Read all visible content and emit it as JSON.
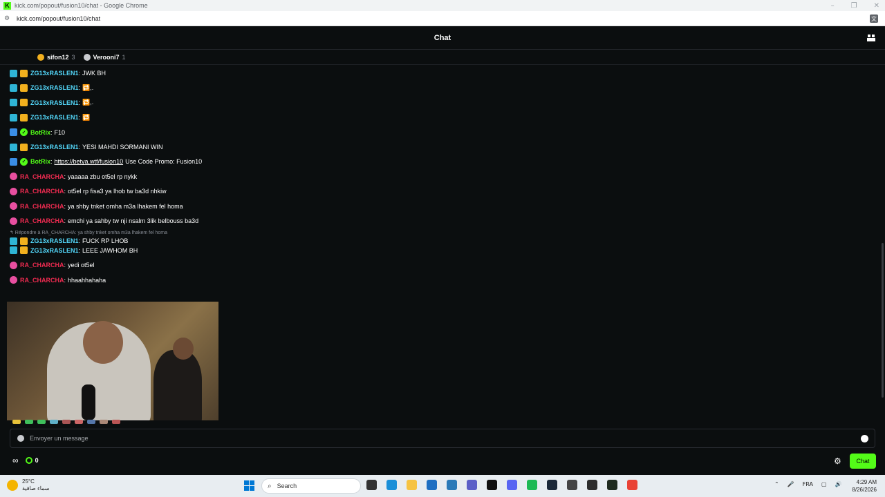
{
  "browser": {
    "window_title": "kick.com/popout/fusion10/chat - Google Chrome",
    "favicon_letter": "K",
    "url": "kick.com/popout/fusion10/chat"
  },
  "header": {
    "title": "Chat"
  },
  "gifters": [
    {
      "name": "sifon12",
      "count": "3",
      "color": "#f2b01e"
    },
    {
      "name": "Verooni7",
      "count": "1",
      "color": "#c9cbcf"
    }
  ],
  "messages": [
    {
      "badges": [
        "sub",
        "crown"
      ],
      "user": "ZG13xRASLEN1",
      "user_color": "#53d8fb",
      "text": "JWK BH",
      "link": ""
    },
    {
      "badges": [
        "sub",
        "crown"
      ],
      "user": "ZG13xRASLEN1",
      "user_color": "#53d8fb",
      "text": "🔁,.",
      "link": ""
    },
    {
      "badges": [
        "sub",
        "crown"
      ],
      "user": "ZG13xRASLEN1",
      "user_color": "#53d8fb",
      "text": "🔁,.",
      "link": ""
    },
    {
      "badges": [
        "sub",
        "crown"
      ],
      "user": "ZG13xRASLEN1",
      "user_color": "#53d8fb",
      "text": "🔁",
      "link": ""
    },
    {
      "badges": [
        "bot",
        "verified"
      ],
      "user": "BotRix",
      "user_color": "#53fc18",
      "text": "F10",
      "link": ""
    },
    {
      "badges": [
        "sub",
        "crown"
      ],
      "user": "ZG13xRASLEN1",
      "user_color": "#53d8fb",
      "text": "YESI MAHDI SORMANI WIN",
      "link": ""
    },
    {
      "badges": [
        "bot",
        "verified"
      ],
      "user": "BotRix",
      "user_color": "#53fc18",
      "text": "Use Code Promo: Fusion10",
      "link": "https://betya.wtf/fusion10"
    },
    {
      "badges": [
        "og"
      ],
      "user": "RA_CHARCHA",
      "user_color": "#ee2b50",
      "text": "yaaaaa zbu ot5el rp nykk",
      "link": ""
    },
    {
      "badges": [
        "og"
      ],
      "user": "RA_CHARCHA",
      "user_color": "#ee2b50",
      "text": "ot5el rp fisa3 ya lhob tw ba3d nhkiw",
      "link": ""
    },
    {
      "badges": [
        "og"
      ],
      "user": "RA_CHARCHA",
      "user_color": "#ee2b50",
      "text": "ya shby tnket omha m3a lhakem fel homa",
      "link": ""
    },
    {
      "badges": [
        "og"
      ],
      "user": "RA_CHARCHA",
      "user_color": "#ee2b50",
      "text": "emchi ya sahby tw nji nsalm 3lik belbouss ba3d",
      "link": ""
    },
    {
      "badges": [
        "sub",
        "crown"
      ],
      "user": "ZG13xRASLEN1",
      "user_color": "#53d8fb",
      "text": "FUCK RP LHOB",
      "link": "",
      "reply": "↰ Répondre à RA_CHARCHA: ya shby tnket omha m3a lhakem fel homa"
    },
    {
      "badges": [
        "sub",
        "crown"
      ],
      "user": "ZG13xRASLEN1",
      "user_color": "#53d8fb",
      "text": "LEEE JAWHOM BH",
      "link": ""
    },
    {
      "badges": [
        "og"
      ],
      "user": "RA_CHARCHA",
      "user_color": "#ee2b50",
      "text": "yedi ot5el",
      "link": ""
    },
    {
      "badges": [
        "og"
      ],
      "user": "RA_CHARCHA",
      "user_color": "#ee2b50",
      "text": "hhaahhahaha",
      "link": ""
    }
  ],
  "input": {
    "placeholder": "Envoyer un message"
  },
  "bottom": {
    "infinity": "∞",
    "points": "0",
    "chat_button": "Chat"
  },
  "taskbar": {
    "weather_temp": "25°C",
    "weather_desc": "سماء صافية",
    "search_label": "Search",
    "language": "FRA",
    "time": "4:29 AM",
    "date": "8/26/2026"
  },
  "colors": {
    "accent": "#53fc18",
    "background": "#0b0e0f"
  }
}
